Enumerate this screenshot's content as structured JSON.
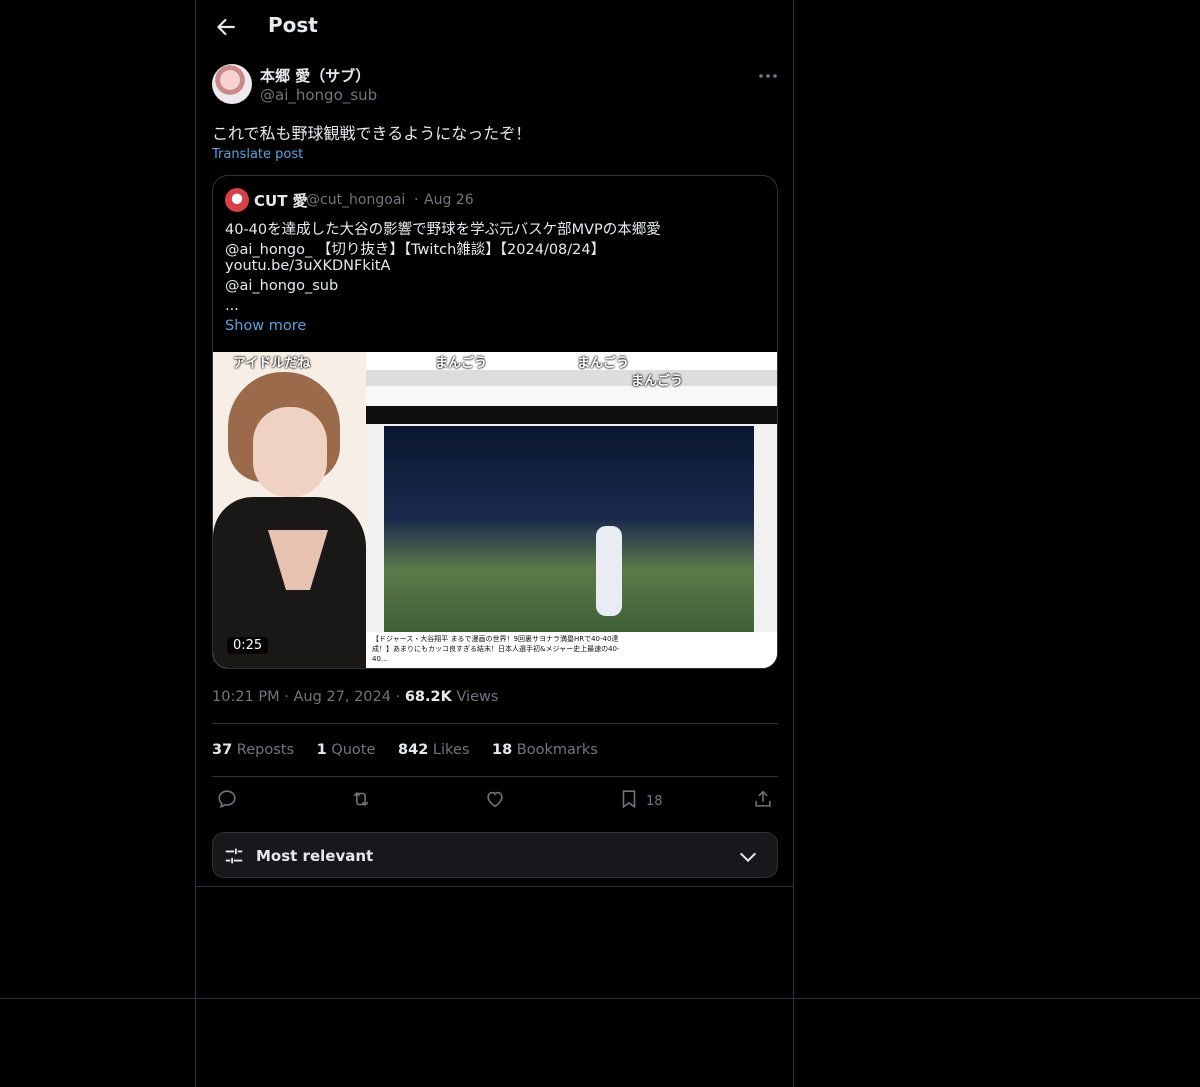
{
  "header": {
    "title": "Post"
  },
  "post": {
    "author_name": "本郷 愛（サブ）",
    "author_handle": "@ai_hongo_sub",
    "text": "これで私も野球観戦できるようになったぞ！",
    "translate_label": "Translate post",
    "time": "10:21 PM",
    "date": "Aug 27, 2024",
    "views_count": "68.2K",
    "views_label": "Views"
  },
  "quote": {
    "name": "CUT 愛",
    "handle": "@cut_hongoai",
    "date": "Aug 26",
    "lines": [
      "40-40を達成した大谷の影響で野球を学ぶ元バスケ部MVPの本郷愛",
      " @ai_hongo_ 【切り抜き】【Twitch雑談】【2024/08/24】",
      "youtu.be/3uXKDNFkitA",
      "@ai_hongo_sub",
      "..."
    ],
    "show_more": "Show more",
    "media": {
      "duration": "0:25",
      "captions": [
        "アイドルだね",
        "まんごう",
        "まんごう",
        "まんごう"
      ],
      "video_title": "【ドジャース・大谷翔平 まるで漫画の世界！9回裏サヨナラ満塁HRで40-40達成！】あまりにもカッコ良すぎる結末！日本人選手初&メジャー史上最速の40-40..."
    }
  },
  "stats": [
    {
      "count": "37",
      "label": "Reposts"
    },
    {
      "count": "1",
      "label": "Quote"
    },
    {
      "count": "842",
      "label": "Likes"
    },
    {
      "count": "18",
      "label": "Bookmarks"
    }
  ],
  "actions": {
    "bookmark_count": "18"
  },
  "sort": {
    "label": "Most relevant"
  }
}
